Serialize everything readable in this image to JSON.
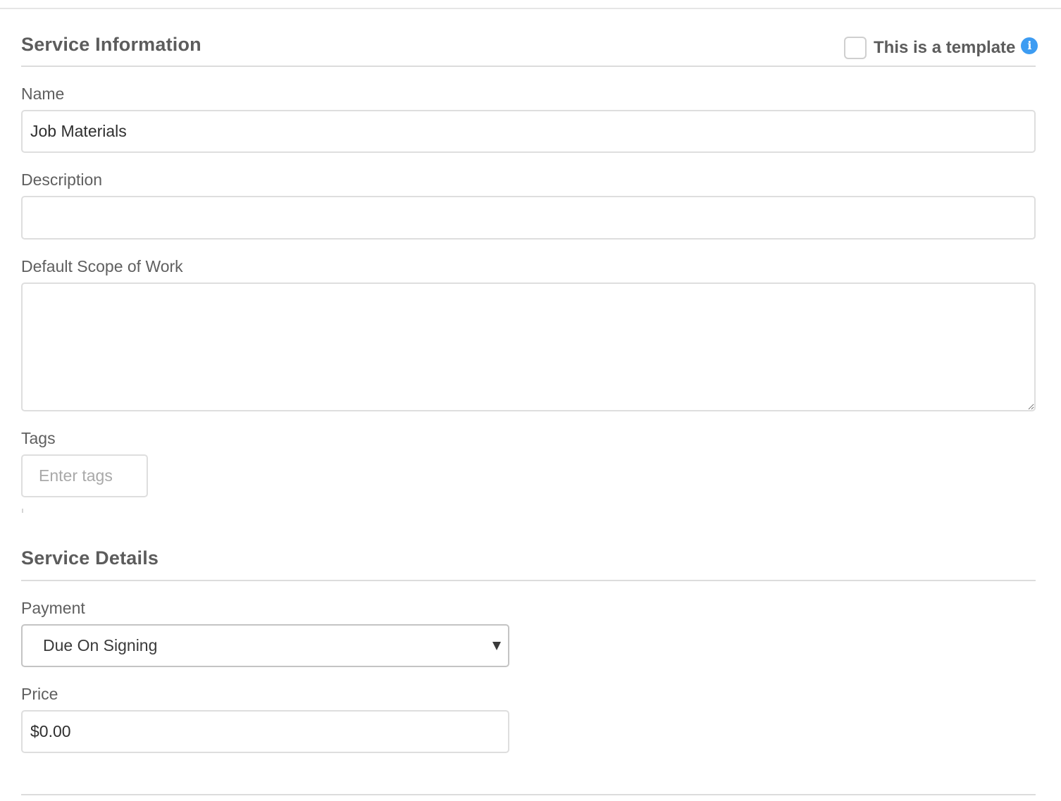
{
  "service_information": {
    "title": "Service Information",
    "template_checkbox": {
      "label": "This is a template",
      "checked": false,
      "info_icon": "info-icon",
      "info_glyph": "i"
    },
    "name": {
      "label": "Name",
      "value": "Job Materials"
    },
    "description": {
      "label": "Description",
      "value": ""
    },
    "default_scope_of_work": {
      "label": "Default Scope of Work",
      "value": ""
    },
    "tags": {
      "label": "Tags",
      "placeholder": "Enter tags"
    }
  },
  "service_details": {
    "title": "Service Details",
    "payment": {
      "label": "Payment",
      "selected": "Due On Signing"
    },
    "price": {
      "label": "Price",
      "value": "$0.00"
    }
  },
  "colors": {
    "info_icon": "#3d9cf2",
    "text": "#5f5f5f",
    "border": "#dedede"
  }
}
